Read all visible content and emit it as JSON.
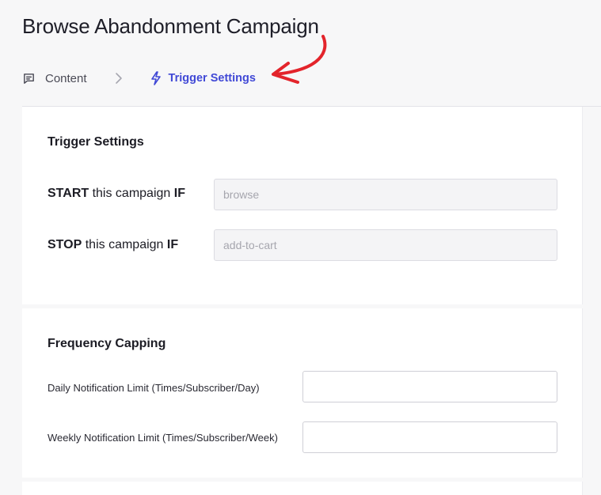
{
  "page": {
    "title": "Browse Abandonment Campaign"
  },
  "steps": [
    {
      "label": "Content",
      "icon": "message-square-icon",
      "active": false
    },
    {
      "label": "Trigger Settings",
      "icon": "lightning-icon",
      "active": true
    }
  ],
  "colors": {
    "accent": "#4149d6",
    "annotation": "#e3242b"
  },
  "trigger_settings": {
    "title": "Trigger Settings",
    "start": {
      "prefix": "START",
      "middle": " this campaign ",
      "suffix": "IF",
      "placeholder": "browse"
    },
    "stop": {
      "prefix": "STOP",
      "middle": " this campaign ",
      "suffix": "IF",
      "placeholder": "add-to-cart"
    }
  },
  "frequency_capping": {
    "title": "Frequency Capping",
    "daily": {
      "label": "Daily Notification Limit (Times/Subscriber/Day)",
      "value": ""
    },
    "weekly": {
      "label": "Weekly Notification Limit (Times/Subscriber/Week)",
      "value": ""
    }
  }
}
